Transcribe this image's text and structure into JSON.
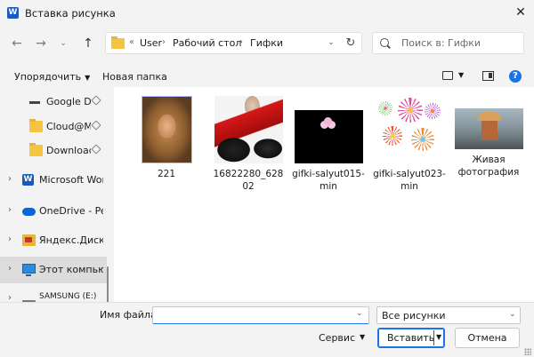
{
  "window": {
    "title": "Вставка рисунка"
  },
  "nav": {
    "breadcrumb": [
      "User",
      "Рабочий стол",
      "Гифки"
    ],
    "overflow": "«"
  },
  "search": {
    "placeholder": "Поиск в: Гифки"
  },
  "commandbar": {
    "organize_label": "Упорядочить",
    "new_folder_label": "Новая папка"
  },
  "sidebar": {
    "items": [
      {
        "label": "Google Drive",
        "icon": "dash-icon"
      },
      {
        "label": "Cloud@Mail",
        "icon": "folder-icon"
      },
      {
        "label": "Downloads",
        "icon": "folder-icon"
      },
      {
        "label": "Microsoft Word",
        "icon": "word-icon"
      },
      {
        "label": "OneDrive - Personal",
        "icon": "cloud-icon"
      },
      {
        "label": "Яндекс.Диск",
        "icon": "yandex-disk-icon"
      },
      {
        "label": "Этот компьютер",
        "icon": "computer-icon"
      },
      {
        "label": "SAMSUNG (E:)",
        "icon": "drive-icon"
      }
    ]
  },
  "files": [
    {
      "name": "221"
    },
    {
      "name": "16822280_62802"
    },
    {
      "name": "gifki-salyut015-min"
    },
    {
      "name": "gifki-salyut023-min"
    },
    {
      "name": "Живая фотография"
    }
  ],
  "footer": {
    "filename_label": "Имя файла:",
    "filename_value": "",
    "filter_value": "Все рисунки",
    "tools_label": "Сервис",
    "insert_label": "Вставить",
    "cancel_label": "Отмена"
  },
  "colors": {
    "accent": "#1a73e8",
    "folder": "#f5c542",
    "word": "#185abd"
  }
}
